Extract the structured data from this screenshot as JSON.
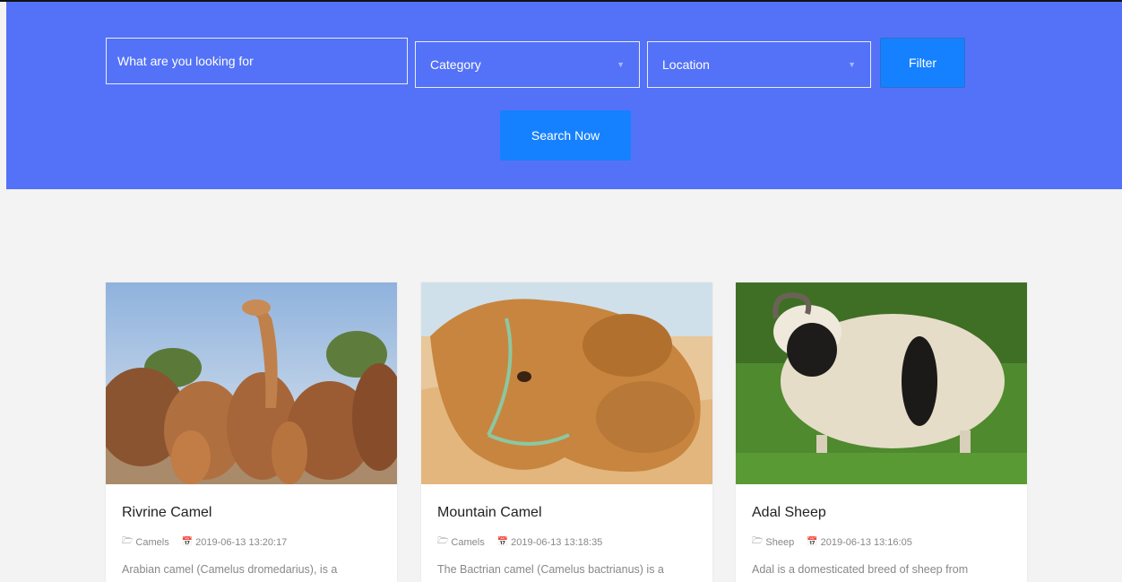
{
  "search": {
    "placeholder": "What are you looking for",
    "category": "Category",
    "location": "Location",
    "filter_label": "Filter",
    "search_label": "Search Now"
  },
  "colors": {
    "hero": "#5472f7",
    "button": "#1681ff",
    "page_bg": "#f3f3f3"
  },
  "listings": [
    {
      "title": "Rivrine Camel",
      "category": "Camels",
      "date": "2019-06-13 13:20:17",
      "excerpt": "Arabian camel (Camelus dromedarius), is a",
      "category_icon": "folder-open-icon",
      "date_icon": "calendar-icon"
    },
    {
      "title": "Mountain Camel",
      "category": "Camels",
      "date": "2019-06-13 13:18:35",
      "excerpt": "The Bactrian camel (Camelus bactrianus) is a",
      "category_icon": "folder-open-icon",
      "date_icon": "calendar-icon"
    },
    {
      "title": "Adal Sheep",
      "category": "Sheep",
      "date": "2019-06-13 13:16:05",
      "excerpt": "Adal is a domesticated breed of sheep from",
      "category_icon": "folder-open-icon",
      "date_icon": "calendar-icon"
    }
  ]
}
